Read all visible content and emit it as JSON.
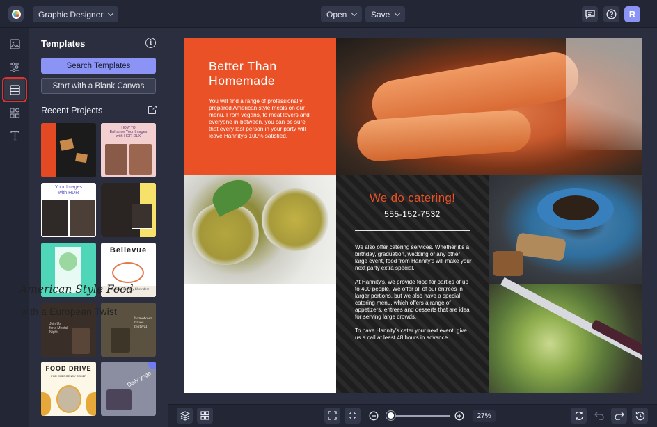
{
  "topbar": {
    "project_type": "Graphic Designer",
    "open_label": "Open",
    "save_label": "Save",
    "avatar_initial": "R"
  },
  "panel": {
    "title": "Templates",
    "search_button": "Search Templates",
    "blank_button": "Start with a Blank Canvas",
    "recent_title": "Recent Projects",
    "thumbs": [
      {
        "line1": "",
        "line2": ""
      },
      {
        "line1": "HOW TO",
        "line2": "Enhance Your Images with HDR DLX"
      },
      {
        "line1": "Your Images",
        "line2": "with HDR"
      },
      {
        "line1": "",
        "line2": ""
      },
      {
        "line1": "",
        "line2": ""
      },
      {
        "line1": "Bellevue",
        "line2": "Join us for monthly bike rides!"
      },
      {
        "line1": "Join Us",
        "line2": "for a Mental Night"
      },
      {
        "line1": "hometown",
        "line2": "blues festival"
      },
      {
        "line1": "FOOD DRIVE",
        "line2": "FOR EMERGENCY RELIEF"
      },
      {
        "line1": "",
        "line2": "Daily yoga"
      }
    ]
  },
  "design": {
    "headline": "Better Than Homemade",
    "intro": "You will find a range of professionally prepared American style meals on our menu. From vegans, to meat lovers and everyone in-between, you can be sure that every last person in your party will leave Hannity's 100% satisfied.",
    "script_title": "American Style Food",
    "sub_title": "with a European Twist",
    "cater_title": "We do catering!",
    "phone": "555-152-7532",
    "cater_p1": "We also offer catering services. Whether it's a birthday, graduation, wedding or any other large event, food from Hannity's will make your next party extra special.",
    "cater_p2": "At Hannity's, we provide food for parties of up to 400 people. We offer all of our entrees in larger portions, but we also have a special catering menu, which offers a range of appetizers, entrees and desserts that are ideal for serving large crowds.",
    "cater_p3": "To have Hannity's cater your next event, give us a call at least 48 hours in advance."
  },
  "bottombar": {
    "zoom": "27%",
    "zoom_level": 0.27
  },
  "colors": {
    "accent": "#8b93f5",
    "brand_orange": "#ea5126",
    "active_highlight": "#e0332a"
  }
}
